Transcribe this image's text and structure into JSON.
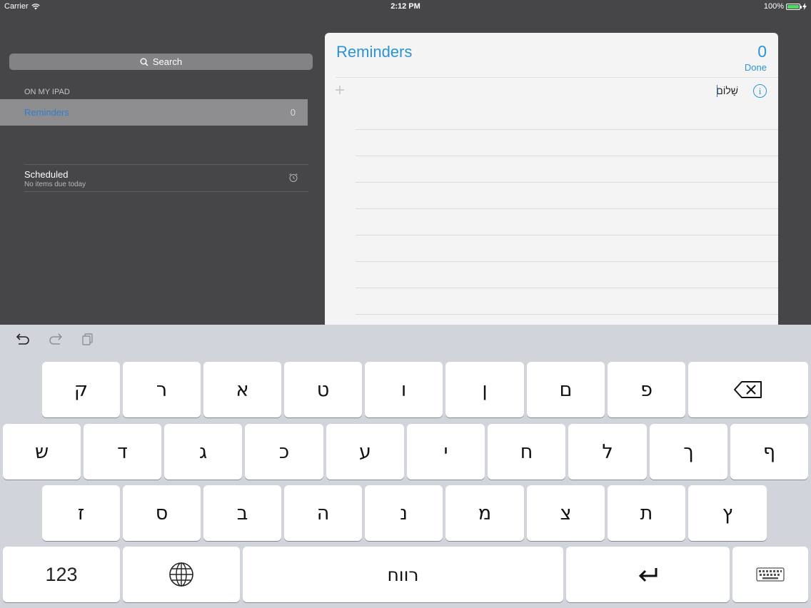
{
  "status_bar": {
    "carrier": "Carrier",
    "time": "2:12 PM",
    "battery": "100%"
  },
  "sidebar": {
    "search_label": "Search",
    "section_label": "ON MY IPAD",
    "list": {
      "name": "Reminders",
      "count": "0"
    },
    "scheduled": {
      "title": "Scheduled",
      "subtitle": "No items due today"
    }
  },
  "panel": {
    "title": "Reminders",
    "count": "0",
    "done_label": "Done",
    "entry_text": "שָׁלוֹם"
  },
  "keyboard": {
    "row1": [
      "ק",
      "ר",
      "א",
      "ט",
      "ו",
      "ן",
      "ם",
      "פ"
    ],
    "row2": [
      "ש",
      "ד",
      "ג",
      "כ",
      "ע",
      "י",
      "ח",
      "ל",
      "ך",
      "ף"
    ],
    "row3": [
      "ז",
      "ס",
      "ב",
      "ה",
      "נ",
      "מ",
      "צ",
      "ת",
      "ץ"
    ],
    "numbers_label": "123",
    "space_label": "רווח"
  },
  "colors": {
    "accent": "#2c93d6",
    "sidebar_bg": "#464547",
    "keyboard_bg": "#d1d5db"
  }
}
